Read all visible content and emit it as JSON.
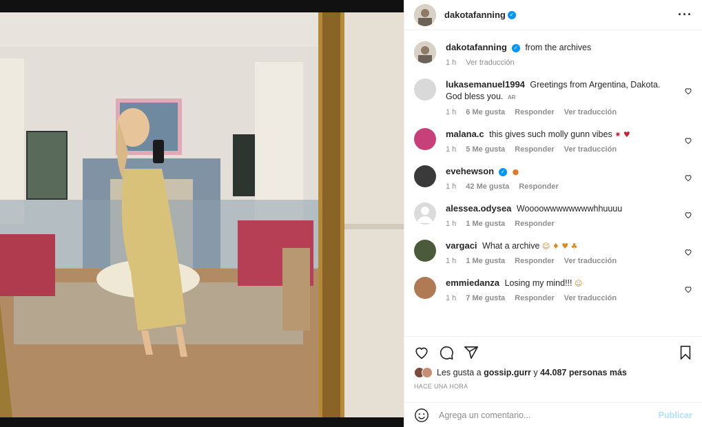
{
  "post": {
    "author": "dakotafanning",
    "caption": "from the archives",
    "caption_time": "1 h",
    "caption_translate": "Ver traducción"
  },
  "comments": [
    {
      "user": "lukasemanuel1994",
      "text": "Greetings from Argentina, Dakota. God bless you.",
      "tag": "AR",
      "time": "1 h",
      "likes": "6 Me gusta",
      "reply": "Responder",
      "translate": "Ver traducción",
      "avatar_color": "#d9d9d9"
    },
    {
      "user": "malana.c",
      "text": "this gives such molly gunn vibes",
      "emoji": "✷ ♥",
      "time": "1 h",
      "likes": "5 Me gusta",
      "reply": "Responder",
      "translate": "Ver traducción",
      "avatar_color": "#c7407a"
    },
    {
      "user": "evehewson",
      "verified": true,
      "text": "",
      "emoji": "●",
      "time": "1 h",
      "likes": "42 Me gusta",
      "reply": "Responder",
      "avatar_color": "#3a3a3a"
    },
    {
      "user": "alessea.odysea",
      "text": "Woooowwwwwwwwhhuuuu",
      "time": "1 h",
      "likes": "1 Me gusta",
      "reply": "Responder",
      "avatar_color": "#dbdbdb"
    },
    {
      "user": "vargaci",
      "text": "What a archive",
      "emoji": "☺ ♦ ♥ ♣",
      "time": "1 h",
      "likes": "1 Me gusta",
      "reply": "Responder",
      "translate": "Ver traducción",
      "avatar_color": "#4b5a3a"
    },
    {
      "user": "emmiedanza",
      "text": "Losing my mind!!!",
      "emoji": "☺",
      "time": "1 h",
      "likes": "7 Me gusta",
      "reply": "Responder",
      "translate": "Ver traducción",
      "avatar_color": "#b07a55"
    }
  ],
  "likes": {
    "prefix": "Les gusta a",
    "user": "gossip.gurr",
    "conj": "y",
    "others": "44.087 personas más"
  },
  "timestamp": "HACE UNA HORA",
  "add_comment": {
    "placeholder": "Agrega un comentario...",
    "publish": "Publicar"
  },
  "icons": {
    "more": "more-options-icon",
    "like": "heart-icon",
    "comment": "comment-icon",
    "share": "share-icon",
    "save": "bookmark-icon",
    "emoji": "emoji-icon"
  },
  "colors": {
    "verified": "#0095f6",
    "publish": "#b2dffc",
    "muted": "#8e8e8e"
  }
}
